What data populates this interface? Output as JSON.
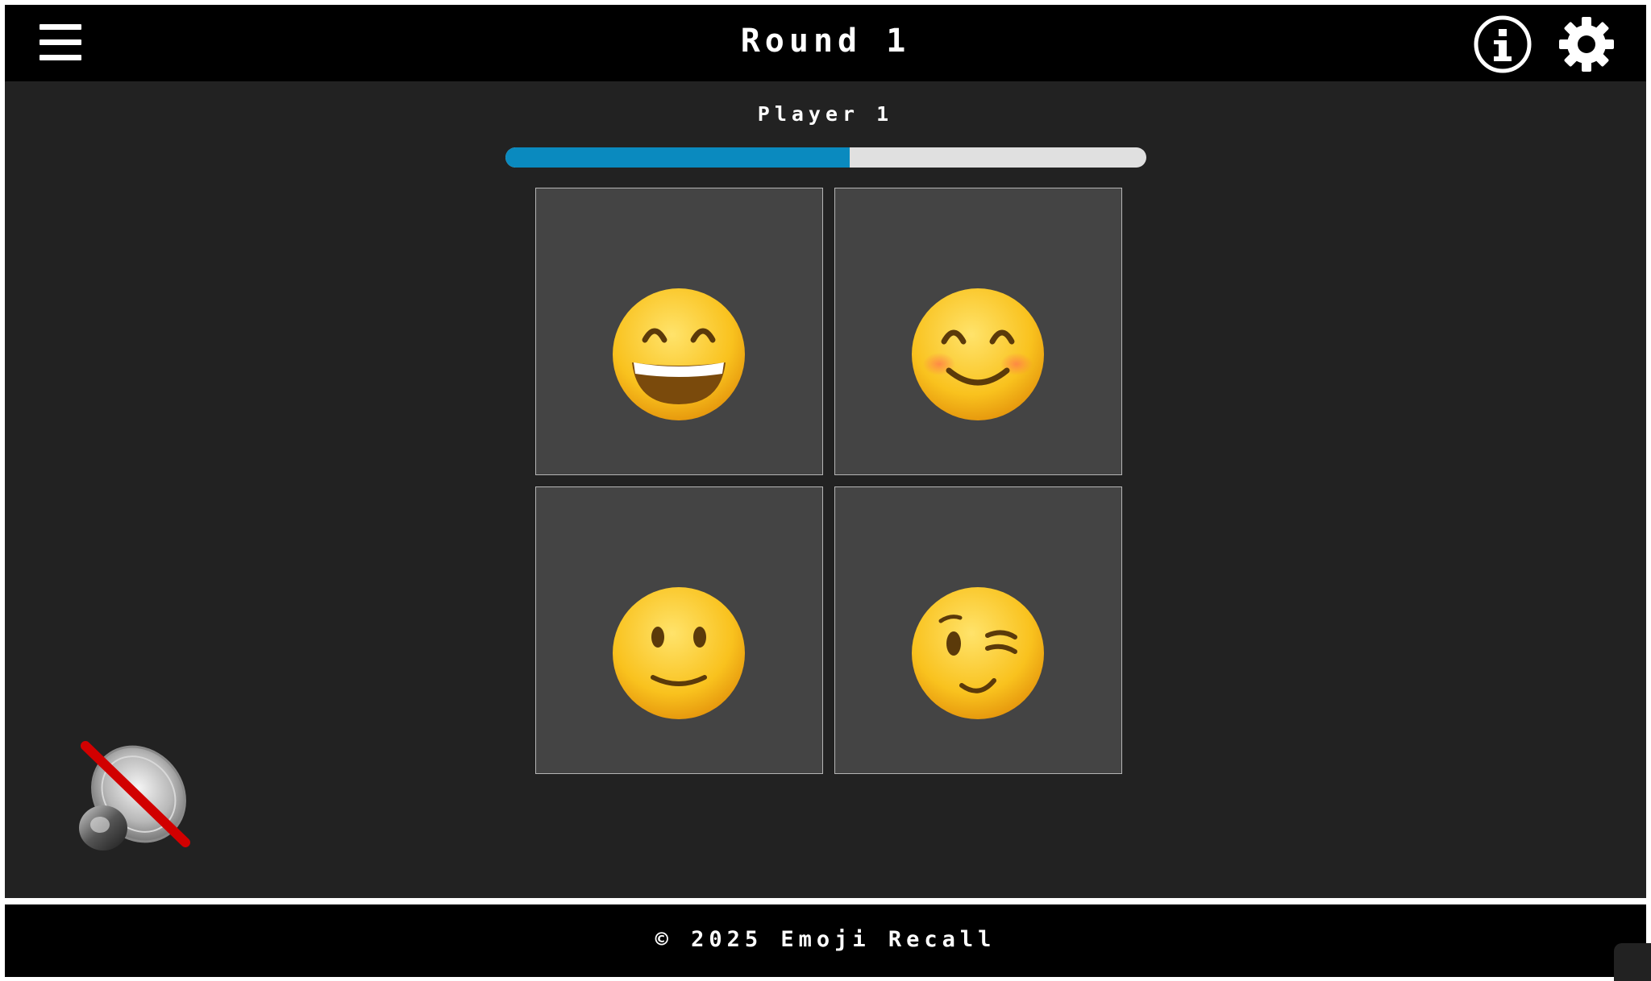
{
  "header": {
    "title": "Round 1",
    "menu_icon": "hamburger-menu-icon",
    "info_icon": "info-icon",
    "settings_icon": "gear-icon"
  },
  "game": {
    "player_label": "Player 1",
    "progress_fraction": 0.537,
    "cards": [
      {
        "emoji": "grinning-face-with-smiling-eyes"
      },
      {
        "emoji": "smiling-face-with-smiling-eyes"
      },
      {
        "emoji": "slightly-smiling-face"
      },
      {
        "emoji": "winking-face"
      }
    ],
    "sound_state": "muted",
    "sound_icon": "speaker-muted-icon"
  },
  "footer": {
    "copyright": "© 2025 Emoji Recall"
  },
  "colors": {
    "header_bg": "#000000",
    "main_bg": "#222222",
    "card_bg": "#444444",
    "progress_fill": "#0a8abf",
    "progress_track": "#e0e0e0",
    "mute_slash": "#d10000"
  }
}
